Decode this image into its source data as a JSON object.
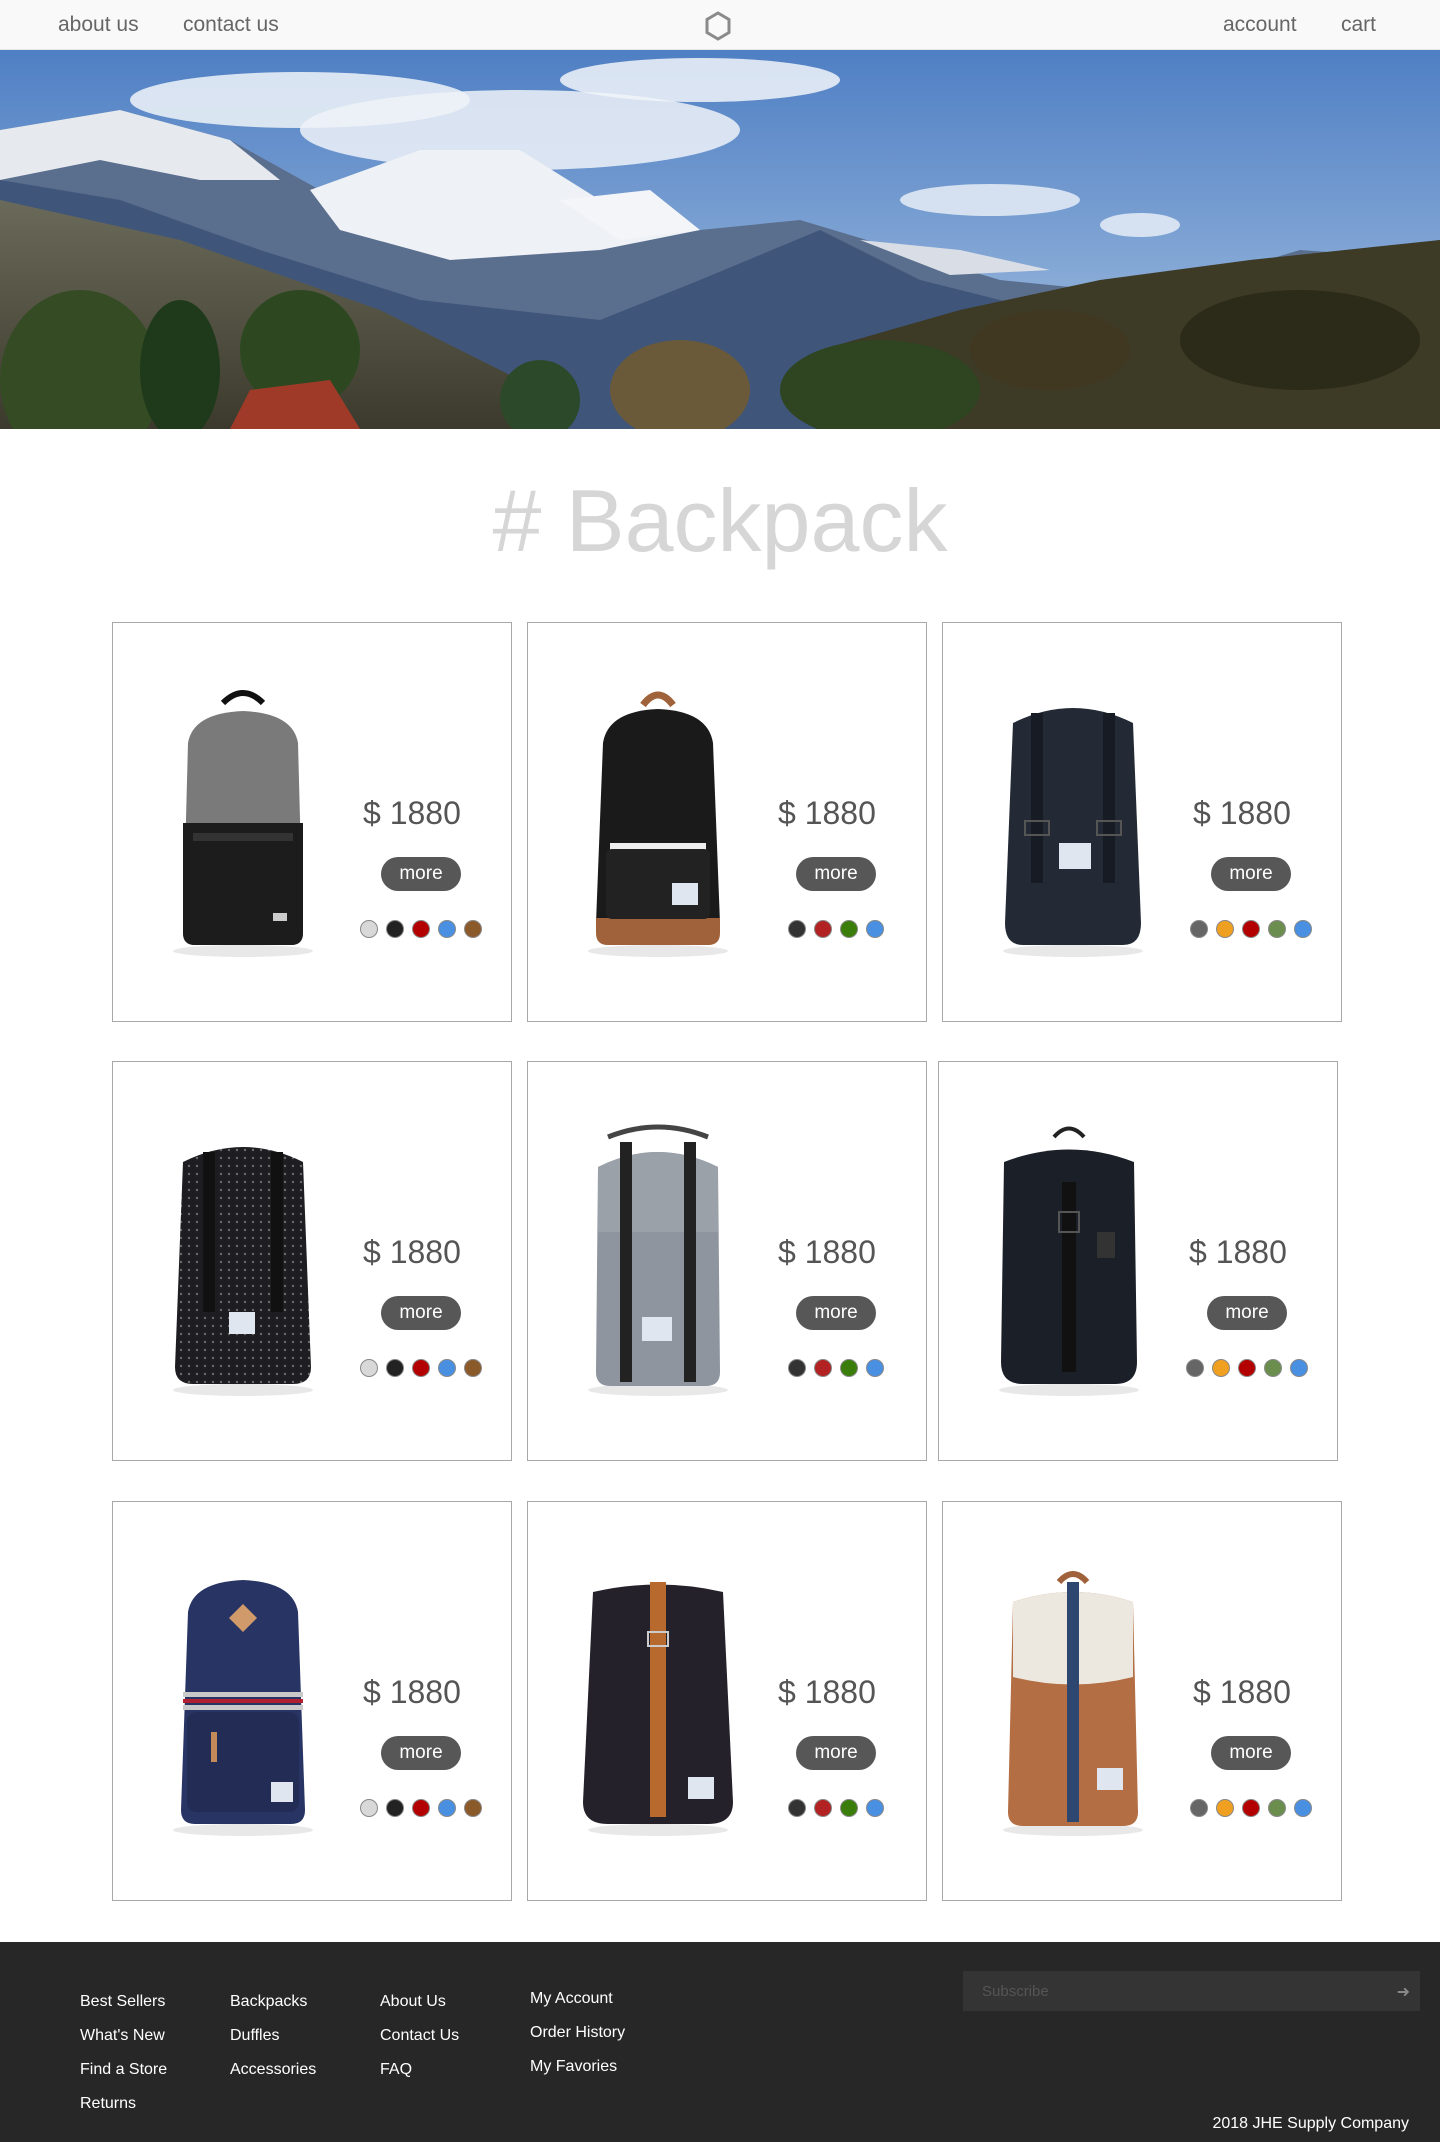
{
  "nav": {
    "about": "about us",
    "contact": "contact us",
    "account": "account",
    "cart": "cart"
  },
  "page_title": "# Backpack",
  "products": [
    {
      "price": "$ 1880",
      "more": "more",
      "colors": [
        "#d8d8d8",
        "#222222",
        "#b30000",
        "#4a90e2",
        "#8b5a2b"
      ],
      "bag": "gray-black"
    },
    {
      "price": "$ 1880",
      "more": "more",
      "colors": [
        "#333333",
        "#b22222",
        "#3a7d0a",
        "#4a90e2"
      ],
      "bag": "black-tan"
    },
    {
      "price": "$ 1880",
      "more": "more",
      "colors": [
        "#666666",
        "#f0a020",
        "#b30000",
        "#6b8e4e",
        "#4a90e2"
      ],
      "bag": "navy-strap"
    },
    {
      "price": "$ 1880",
      "more": "more",
      "colors": [
        "#d8d8d8",
        "#222222",
        "#b30000",
        "#4a90e2",
        "#8b5a2b"
      ],
      "bag": "dotted-black"
    },
    {
      "price": "$ 1880",
      "more": "more",
      "colors": [
        "#333333",
        "#b22222",
        "#3a7d0a",
        "#4a90e2"
      ],
      "bag": "gray-strap"
    },
    {
      "price": "$ 1880",
      "more": "more",
      "colors": [
        "#666666",
        "#f0a020",
        "#b30000",
        "#6b8e4e",
        "#4a90e2"
      ],
      "bag": "black-buckle"
    },
    {
      "price": "$ 1880",
      "more": "more",
      "colors": [
        "#d8d8d8",
        "#222222",
        "#b30000",
        "#4a90e2",
        "#8b5a2b"
      ],
      "bag": "navy-patch"
    },
    {
      "price": "$ 1880",
      "more": "more",
      "colors": [
        "#333333",
        "#b22222",
        "#3a7d0a",
        "#4a90e2"
      ],
      "bag": "black-orange-strap"
    },
    {
      "price": "$ 1880",
      "more": "more",
      "colors": [
        "#666666",
        "#f0a020",
        "#b30000",
        "#6b8e4e",
        "#4a90e2"
      ],
      "bag": "tan-cream"
    }
  ],
  "footer": {
    "col1": [
      "Best Sellers",
      "What's New",
      "Find a Store",
      "Returns"
    ],
    "col2": [
      "Backpacks",
      "Duffles",
      "Accessories"
    ],
    "col3": [
      "About Us",
      "Contact Us",
      "FAQ"
    ],
    "col4": [
      "My Account",
      "Order History",
      "My Favories"
    ],
    "subscribe_placeholder": "Subscribe",
    "copyright": "2018 JHE Supply Company"
  }
}
